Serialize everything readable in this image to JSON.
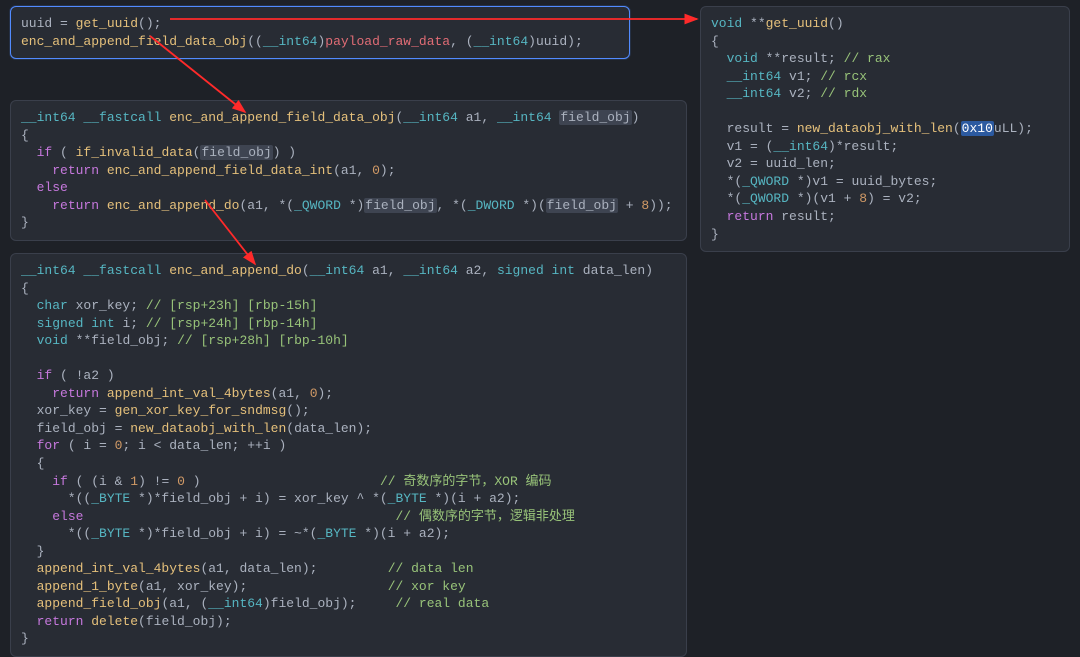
{
  "domain": "Computer-Use",
  "panels": {
    "p1": {
      "lines": [
        [
          {
            "cls": "t-var",
            "text": "uuid "
          },
          {
            "cls": "t-punct",
            "text": "= "
          },
          {
            "cls": "t-func",
            "text": "get_uuid"
          },
          {
            "cls": "t-punct",
            "text": "();"
          }
        ],
        [
          {
            "cls": "t-func",
            "text": "enc_and_append_field_data_obj"
          },
          {
            "cls": "t-punct",
            "text": "(("
          },
          {
            "cls": "t-type",
            "text": "__int64"
          },
          {
            "cls": "t-punct",
            "text": ")"
          },
          {
            "cls": "t-hl-var",
            "text": "payload_raw_data"
          },
          {
            "cls": "t-punct",
            "text": ", ("
          },
          {
            "cls": "t-type",
            "text": "__int64"
          },
          {
            "cls": "t-punct",
            "text": ")"
          },
          {
            "cls": "t-var",
            "text": "uuid"
          },
          {
            "cls": "t-punct",
            "text": ");"
          }
        ]
      ]
    },
    "p2": {
      "lines": [
        [
          {
            "cls": "t-type",
            "text": "__int64 __fastcall "
          },
          {
            "cls": "t-func",
            "text": "enc_and_append_field_data_obj"
          },
          {
            "cls": "t-punct",
            "text": "("
          },
          {
            "cls": "t-type",
            "text": "__int64 "
          },
          {
            "cls": "t-var",
            "text": "a1"
          },
          {
            "cls": "t-punct",
            "text": ", "
          },
          {
            "cls": "t-type",
            "text": "__int64 "
          },
          {
            "cls": "hl-box t-var",
            "text": "field_obj"
          },
          {
            "cls": "t-punct",
            "text": ")"
          }
        ],
        [
          {
            "cls": "t-punct",
            "text": "{"
          }
        ],
        [
          {
            "cls": "t-punct",
            "text": "  "
          },
          {
            "cls": "t-kw",
            "text": "if"
          },
          {
            "cls": "t-punct",
            "text": " ( "
          },
          {
            "cls": "t-func",
            "text": "if_invalid_data"
          },
          {
            "cls": "t-punct",
            "text": "("
          },
          {
            "cls": "hl-box t-var",
            "text": "field_obj"
          },
          {
            "cls": "t-punct",
            "text": ") )"
          }
        ],
        [
          {
            "cls": "t-punct",
            "text": "    "
          },
          {
            "cls": "t-kw",
            "text": "return"
          },
          {
            "cls": "t-punct",
            "text": " "
          },
          {
            "cls": "t-func",
            "text": "enc_and_append_field_data_int"
          },
          {
            "cls": "t-punct",
            "text": "(a1, "
          },
          {
            "cls": "t-num",
            "text": "0"
          },
          {
            "cls": "t-punct",
            "text": ");"
          }
        ],
        [
          {
            "cls": "t-punct",
            "text": "  "
          },
          {
            "cls": "t-kw",
            "text": "else"
          }
        ],
        [
          {
            "cls": "t-punct",
            "text": "    "
          },
          {
            "cls": "t-kw",
            "text": "return"
          },
          {
            "cls": "t-punct",
            "text": " "
          },
          {
            "cls": "t-func",
            "text": "enc_and_append_do"
          },
          {
            "cls": "t-punct",
            "text": "(a1, *("
          },
          {
            "cls": "t-type",
            "text": "_QWORD "
          },
          {
            "cls": "t-punct",
            "text": "*)"
          },
          {
            "cls": "hl-box t-var",
            "text": "field_obj"
          },
          {
            "cls": "t-punct",
            "text": ", *("
          },
          {
            "cls": "t-type",
            "text": "_DWORD "
          },
          {
            "cls": "t-punct",
            "text": "*)("
          },
          {
            "cls": "hl-box t-var",
            "text": "field_obj"
          },
          {
            "cls": "t-punct",
            "text": " + "
          },
          {
            "cls": "t-num",
            "text": "8"
          },
          {
            "cls": "t-punct",
            "text": "));"
          }
        ],
        [
          {
            "cls": "t-punct",
            "text": "}"
          }
        ]
      ]
    },
    "p3": {
      "lines": [
        [
          {
            "cls": "t-type",
            "text": "__int64 __fastcall "
          },
          {
            "cls": "t-func",
            "text": "enc_and_append_do"
          },
          {
            "cls": "t-punct",
            "text": "("
          },
          {
            "cls": "t-type",
            "text": "__int64 "
          },
          {
            "cls": "t-var",
            "text": "a1"
          },
          {
            "cls": "t-punct",
            "text": ", "
          },
          {
            "cls": "t-type",
            "text": "__int64 "
          },
          {
            "cls": "t-var",
            "text": "a2"
          },
          {
            "cls": "t-punct",
            "text": ", "
          },
          {
            "cls": "t-type",
            "text": "signed int "
          },
          {
            "cls": "t-var",
            "text": "data_len"
          },
          {
            "cls": "t-punct",
            "text": ")"
          }
        ],
        [
          {
            "cls": "t-punct",
            "text": "{"
          }
        ],
        [
          {
            "cls": "t-punct",
            "text": "  "
          },
          {
            "cls": "t-type",
            "text": "char "
          },
          {
            "cls": "t-var",
            "text": "xor_key"
          },
          {
            "cls": "t-punct",
            "text": "; "
          },
          {
            "cls": "t-comment",
            "text": "// [rsp+23h] [rbp-15h]"
          }
        ],
        [
          {
            "cls": "t-punct",
            "text": "  "
          },
          {
            "cls": "t-type",
            "text": "signed int "
          },
          {
            "cls": "t-var",
            "text": "i"
          },
          {
            "cls": "t-punct",
            "text": "; "
          },
          {
            "cls": "t-comment",
            "text": "// [rsp+24h] [rbp-14h]"
          }
        ],
        [
          {
            "cls": "t-punct",
            "text": "  "
          },
          {
            "cls": "t-type",
            "text": "void "
          },
          {
            "cls": "t-punct",
            "text": "**"
          },
          {
            "cls": "t-var",
            "text": "field_obj"
          },
          {
            "cls": "t-punct",
            "text": "; "
          },
          {
            "cls": "t-comment",
            "text": "// [rsp+28h] [rbp-10h]"
          }
        ],
        [
          {
            "cls": "t-punct",
            "text": ""
          }
        ],
        [
          {
            "cls": "t-punct",
            "text": "  "
          },
          {
            "cls": "t-kw",
            "text": "if"
          },
          {
            "cls": "t-punct",
            "text": " ( !a2 )"
          }
        ],
        [
          {
            "cls": "t-punct",
            "text": "    "
          },
          {
            "cls": "t-kw",
            "text": "return"
          },
          {
            "cls": "t-punct",
            "text": " "
          },
          {
            "cls": "t-func",
            "text": "append_int_val_4bytes"
          },
          {
            "cls": "t-punct",
            "text": "(a1, "
          },
          {
            "cls": "t-num",
            "text": "0"
          },
          {
            "cls": "t-punct",
            "text": ");"
          }
        ],
        [
          {
            "cls": "t-punct",
            "text": "  "
          },
          {
            "cls": "t-var",
            "text": "xor_key "
          },
          {
            "cls": "t-punct",
            "text": "= "
          },
          {
            "cls": "t-func",
            "text": "gen_xor_key_for_sndmsg"
          },
          {
            "cls": "t-punct",
            "text": "();"
          }
        ],
        [
          {
            "cls": "t-punct",
            "text": "  "
          },
          {
            "cls": "t-var",
            "text": "field_obj "
          },
          {
            "cls": "t-punct",
            "text": "= "
          },
          {
            "cls": "t-func",
            "text": "new_dataobj_with_len"
          },
          {
            "cls": "t-punct",
            "text": "(data_len);"
          }
        ],
        [
          {
            "cls": "t-punct",
            "text": "  "
          },
          {
            "cls": "t-kw",
            "text": "for"
          },
          {
            "cls": "t-punct",
            "text": " ( i = "
          },
          {
            "cls": "t-num",
            "text": "0"
          },
          {
            "cls": "t-punct",
            "text": "; i < data_len; ++i )"
          }
        ],
        [
          {
            "cls": "t-punct",
            "text": "  {"
          }
        ],
        [
          {
            "cls": "t-punct",
            "text": "    "
          },
          {
            "cls": "t-kw",
            "text": "if"
          },
          {
            "cls": "t-punct",
            "text": " ( (i & "
          },
          {
            "cls": "t-num",
            "text": "1"
          },
          {
            "cls": "t-punct",
            "text": ") != "
          },
          {
            "cls": "t-num",
            "text": "0"
          },
          {
            "cls": "t-punct",
            "text": " )"
          },
          {
            "cls": "t-punct",
            "text": "                       "
          },
          {
            "cls": "t-comment",
            "text": "// 奇数序的字节，XOR 编码"
          }
        ],
        [
          {
            "cls": "t-punct",
            "text": "      *(("
          },
          {
            "cls": "t-type",
            "text": "_BYTE "
          },
          {
            "cls": "t-punct",
            "text": "*)*field_obj + i) = xor_key ^ *("
          },
          {
            "cls": "t-type",
            "text": "_BYTE "
          },
          {
            "cls": "t-punct",
            "text": "*)(i + a2);"
          }
        ],
        [
          {
            "cls": "t-punct",
            "text": "    "
          },
          {
            "cls": "t-kw",
            "text": "else"
          },
          {
            "cls": "t-punct",
            "text": "                                        "
          },
          {
            "cls": "t-comment",
            "text": "// 偶数序的字节，逻辑非处理"
          }
        ],
        [
          {
            "cls": "t-punct",
            "text": "      *(("
          },
          {
            "cls": "t-type",
            "text": "_BYTE "
          },
          {
            "cls": "t-punct",
            "text": "*)*field_obj + i) = ~*("
          },
          {
            "cls": "t-type",
            "text": "_BYTE "
          },
          {
            "cls": "t-punct",
            "text": "*)(i + a2);"
          }
        ],
        [
          {
            "cls": "t-punct",
            "text": "  }"
          }
        ],
        [
          {
            "cls": "t-punct",
            "text": "  "
          },
          {
            "cls": "t-func",
            "text": "append_int_val_4bytes"
          },
          {
            "cls": "t-punct",
            "text": "(a1, data_len);"
          },
          {
            "cls": "t-punct",
            "text": "         "
          },
          {
            "cls": "t-comment",
            "text": "// data len"
          }
        ],
        [
          {
            "cls": "t-punct",
            "text": "  "
          },
          {
            "cls": "t-func",
            "text": "append_1_byte"
          },
          {
            "cls": "t-punct",
            "text": "(a1, xor_key);"
          },
          {
            "cls": "t-punct",
            "text": "                  "
          },
          {
            "cls": "t-comment",
            "text": "// xor key"
          }
        ],
        [
          {
            "cls": "t-punct",
            "text": "  "
          },
          {
            "cls": "t-func",
            "text": "append_field_obj"
          },
          {
            "cls": "t-punct",
            "text": "(a1, ("
          },
          {
            "cls": "t-type",
            "text": "__int64"
          },
          {
            "cls": "t-punct",
            "text": ")field_obj);"
          },
          {
            "cls": "t-punct",
            "text": "     "
          },
          {
            "cls": "t-comment",
            "text": "// real data"
          }
        ],
        [
          {
            "cls": "t-punct",
            "text": "  "
          },
          {
            "cls": "t-kw",
            "text": "return"
          },
          {
            "cls": "t-punct",
            "text": " "
          },
          {
            "cls": "t-func",
            "text": "delete"
          },
          {
            "cls": "t-punct",
            "text": "(field_obj);"
          }
        ],
        [
          {
            "cls": "t-punct",
            "text": "}"
          }
        ]
      ]
    },
    "p4": {
      "lines": [
        [
          {
            "cls": "t-type",
            "text": "void "
          },
          {
            "cls": "t-punct",
            "text": "**"
          },
          {
            "cls": "t-func",
            "text": "get_uuid"
          },
          {
            "cls": "t-punct",
            "text": "()"
          }
        ],
        [
          {
            "cls": "t-punct",
            "text": "{"
          }
        ],
        [
          {
            "cls": "t-punct",
            "text": "  "
          },
          {
            "cls": "t-type",
            "text": "void "
          },
          {
            "cls": "t-punct",
            "text": "**result; "
          },
          {
            "cls": "t-comment",
            "text": "// rax"
          }
        ],
        [
          {
            "cls": "t-punct",
            "text": "  "
          },
          {
            "cls": "t-type",
            "text": "__int64 "
          },
          {
            "cls": "t-var",
            "text": "v1"
          },
          {
            "cls": "t-punct",
            "text": "; "
          },
          {
            "cls": "t-comment",
            "text": "// rcx"
          }
        ],
        [
          {
            "cls": "t-punct",
            "text": "  "
          },
          {
            "cls": "t-type",
            "text": "__int64 "
          },
          {
            "cls": "t-var",
            "text": "v2"
          },
          {
            "cls": "t-punct",
            "text": "; "
          },
          {
            "cls": "t-comment",
            "text": "// rdx"
          }
        ],
        [
          {
            "cls": "t-punct",
            "text": ""
          }
        ],
        [
          {
            "cls": "t-punct",
            "text": "  result = "
          },
          {
            "cls": "t-func",
            "text": "new_dataobj_with_len"
          },
          {
            "cls": "t-punct",
            "text": "("
          },
          {
            "cls": "sel-box",
            "text": "0x10"
          },
          {
            "cls": "t-punct",
            "text": "uLL);"
          }
        ],
        [
          {
            "cls": "t-punct",
            "text": "  v1 = ("
          },
          {
            "cls": "t-type",
            "text": "__int64"
          },
          {
            "cls": "t-punct",
            "text": ")*result;"
          }
        ],
        [
          {
            "cls": "t-punct",
            "text": "  v2 = "
          },
          {
            "cls": "t-var",
            "text": "uuid_len"
          },
          {
            "cls": "t-punct",
            "text": ";"
          }
        ],
        [
          {
            "cls": "t-punct",
            "text": "  *("
          },
          {
            "cls": "t-type",
            "text": "_QWORD "
          },
          {
            "cls": "t-punct",
            "text": "*)v1 = "
          },
          {
            "cls": "t-var",
            "text": "uuid_bytes"
          },
          {
            "cls": "t-punct",
            "text": ";"
          }
        ],
        [
          {
            "cls": "t-punct",
            "text": "  *("
          },
          {
            "cls": "t-type",
            "text": "_QWORD "
          },
          {
            "cls": "t-punct",
            "text": "*)(v1 + "
          },
          {
            "cls": "t-num",
            "text": "8"
          },
          {
            "cls": "t-punct",
            "text": ") = v2;"
          }
        ],
        [
          {
            "cls": "t-punct",
            "text": "  "
          },
          {
            "cls": "t-kw",
            "text": "return"
          },
          {
            "cls": "t-punct",
            "text": " result;"
          }
        ],
        [
          {
            "cls": "t-punct",
            "text": "}"
          }
        ]
      ]
    }
  }
}
